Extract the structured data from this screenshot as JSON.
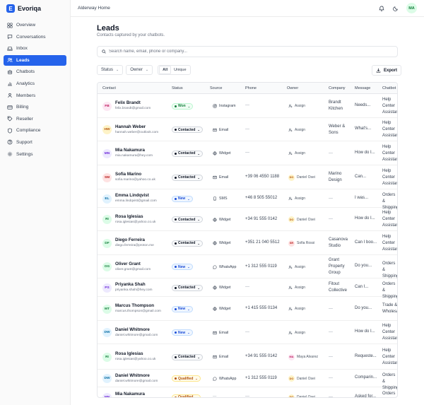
{
  "brand": {
    "name": "Evoriqa",
    "logo_letter": "E",
    "accent": "#2563eb"
  },
  "sidebar": {
    "items": [
      {
        "label": "Overview",
        "icon": "grid-icon"
      },
      {
        "label": "Conversations",
        "icon": "chat-icon"
      },
      {
        "label": "Inbox",
        "icon": "inbox-icon"
      },
      {
        "label": "Leads",
        "icon": "users-icon",
        "active": true
      },
      {
        "label": "Chatbots",
        "icon": "bot-icon"
      },
      {
        "label": "Analytics",
        "icon": "chart-icon"
      },
      {
        "label": "Members",
        "icon": "members-icon"
      },
      {
        "label": "Billing",
        "icon": "card-icon"
      },
      {
        "label": "Reseller",
        "icon": "tag-icon"
      },
      {
        "label": "Compliance",
        "icon": "shield-icon"
      },
      {
        "label": "Support",
        "icon": "help-icon"
      },
      {
        "label": "Settings",
        "icon": "gear-icon"
      }
    ]
  },
  "header": {
    "breadcrumb": "Alderway Home",
    "user_initials": "MA"
  },
  "page": {
    "title": "Leads",
    "subtitle": "Contacts captured by your chatbots.",
    "search_placeholder": "Search name, email, phone or company..."
  },
  "filters": {
    "status": "Status",
    "owner": "Owner",
    "seg_all": "All",
    "seg_unique": "Unique",
    "export": "Export"
  },
  "table": {
    "columns": [
      "Contact",
      "Status",
      "Source",
      "Phone",
      "Owner",
      "Company",
      "Message",
      "Chatbot"
    ],
    "rows": [
      {
        "initials": "FB",
        "name": "Felix Brandt",
        "email": "felix.brandt@gmail.com",
        "status": "Won",
        "source": "Instagram",
        "phone": "—",
        "owner": "Assign",
        "owner_initials": "",
        "company": "Brandt\nKitchen",
        "message": "Needs...",
        "chatbot": "Help\nCenter\nAssistant",
        "avatar_bg": "#fce7f3",
        "avatar_fg": "#be185d"
      },
      {
        "initials": "HW",
        "name": "Hannah Weber",
        "email": "hannah.weber@outlook.com",
        "status": "Contacted",
        "source": "Email",
        "phone": "—",
        "owner": "Assign",
        "owner_initials": "",
        "company": "Weber &\nSons",
        "message": "What's...",
        "chatbot": "Help\nCenter\nAssistant",
        "avatar_bg": "#fef3c7",
        "avatar_fg": "#b45309"
      },
      {
        "initials": "MN",
        "name": "Mia Nakamura",
        "email": "mia.nakamura@hey.com",
        "status": "Contacted",
        "source": "Widget",
        "phone": "—",
        "owner": "Assign",
        "owner_initials": "",
        "company": "—",
        "message": "How do I...",
        "chatbot": "Help\nCenter\nAssistant",
        "avatar_bg": "#ede9fe",
        "avatar_fg": "#6d28d9"
      },
      {
        "initials": "SM",
        "name": "Sofia Marino",
        "email": "sofia.marino@yahoo.co.uk",
        "status": "Contacted",
        "source": "Email",
        "phone": "+39 06 4550 1188",
        "owner": "Daniel Osei",
        "owner_initials": "DO",
        "company": "Marino\nDesign",
        "message": "Can...",
        "chatbot": "Help\nCenter\nAssistant",
        "avatar_bg": "#fee2e2",
        "avatar_fg": "#b91c1c"
      },
      {
        "initials": "EL",
        "name": "Emma Lindqvist",
        "email": "emma.lindqvist@gmail.com",
        "status": "New",
        "source": "SMS",
        "phone": "+46 8 505 55012",
        "owner": "Assign",
        "owner_initials": "",
        "company": "—",
        "message": "I was...",
        "chatbot": "Orders &\nShipping",
        "avatar_bg": "#e0f2fe",
        "avatar_fg": "#0369a1"
      },
      {
        "initials": "RI",
        "name": "Rosa Iglesias",
        "email": "rosa.iglesias@yahoo.co.uk",
        "status": "Contacted",
        "source": "Widget",
        "phone": "+34 91 555 0142",
        "owner": "Daniel Osei",
        "owner_initials": "DO",
        "company": "—",
        "message": "How do I...",
        "chatbot": "Help\nCenter\nAssistant",
        "avatar_bg": "#dcfce7",
        "avatar_fg": "#15803d"
      },
      {
        "initials": "DF",
        "name": "Diego Ferreira",
        "email": "diego.ferreira@proton.me",
        "status": "Contacted",
        "source": "Widget",
        "phone": "+351 21 040 5512",
        "owner": "Sofia Rossi",
        "owner_initials": "SR",
        "company": "Casanova\nStudio",
        "message": "Can I boo...",
        "chatbot": "Help\nCenter\nAssistant",
        "avatar_bg": "#dcfce7",
        "avatar_fg": "#15803d"
      },
      {
        "initials": "OG",
        "name": "Oliver Grant",
        "email": "oliver.grant@gmail.com",
        "status": "New",
        "source": "WhatsApp",
        "phone": "+1 312 555 0119",
        "owner": "Assign",
        "owner_initials": "",
        "company": "Grant\nProperty\nGroup",
        "message": "Do you...",
        "chatbot": "Orders &\nShipping",
        "avatar_bg": "#dcfce7",
        "avatar_fg": "#15803d"
      },
      {
        "initials": "PS",
        "name": "Priyanka Shah",
        "email": "priyanka.shah@hey.com",
        "status": "Contacted",
        "source": "Widget",
        "phone": "—",
        "owner": "Assign",
        "owner_initials": "",
        "company": "Fitout\nCollective",
        "message": "Can I...",
        "chatbot": "Orders &\nShipping",
        "avatar_bg": "#ede9fe",
        "avatar_fg": "#6d28d9"
      },
      {
        "initials": "MT",
        "name": "Marcus Thompson",
        "email": "marcus.thompson@gmail.com",
        "status": "New",
        "source": "Widget",
        "phone": "+1 415 555 0134",
        "owner": "Assign",
        "owner_initials": "",
        "company": "—",
        "message": "Do you...",
        "chatbot": "Trade &\nWholesale",
        "avatar_bg": "#dcfce7",
        "avatar_fg": "#15803d"
      },
      {
        "initials": "DW",
        "name": "Daniel Whitmore",
        "email": "daniel.whitmore@gmail.com",
        "status": "New",
        "source": "Email",
        "phone": "—",
        "owner": "Assign",
        "owner_initials": "",
        "company": "—",
        "message": "How do I...",
        "chatbot": "Help\nCenter\nAssistant",
        "avatar_bg": "#e0f2fe",
        "avatar_fg": "#0369a1"
      },
      {
        "initials": "RI",
        "name": "Rosa Iglesias",
        "email": "rosa.iglesias@yahoo.co.uk",
        "status": "Contacted",
        "source": "Email",
        "phone": "+34 91 555 0142",
        "owner": "Maya Alvarez",
        "owner_initials": "MA",
        "company": "—",
        "message": "Requeste...",
        "chatbot": "Help\nCenter\nAssistant",
        "avatar_bg": "#dcfce7",
        "avatar_fg": "#15803d"
      },
      {
        "initials": "DW",
        "name": "Daniel Whitmore",
        "email": "daniel.whitmore@gmail.com",
        "status": "Qualified",
        "source": "WhatsApp",
        "phone": "+1 312 555 0119",
        "owner": "Daniel Osei",
        "owner_initials": "DO",
        "company": "—",
        "message": "Comparin...",
        "chatbot": "Orders &\nShipping",
        "avatar_bg": "#e0f2fe",
        "avatar_fg": "#0369a1"
      },
      {
        "initials": "MN",
        "name": "Mia Nakamura",
        "email": "mia.nakamura@hey.com",
        "status": "Qualified",
        "source": "—",
        "phone": "—",
        "owner": "Daniel Osei",
        "owner_initials": "DO",
        "company": "—",
        "message": "Asked for...",
        "chatbot": "Orders &\nShipping",
        "avatar_bg": "#ede9fe",
        "avatar_fg": "#6d28d9"
      }
    ]
  },
  "status_colors": {
    "Won": {
      "bg": "#f0fdf4",
      "border": "#bbf7d0",
      "fg": "#15803d"
    },
    "Contacted": {
      "bg": "#f9fafb",
      "border": "#d1d5db",
      "fg": "#111827"
    },
    "New": {
      "bg": "#eff6ff",
      "border": "#bfdbfe",
      "fg": "#1d4ed8"
    },
    "Qualified": {
      "bg": "#fffbeb",
      "border": "#fde68a",
      "fg": "#b45309"
    }
  },
  "owner_colors": {
    "DO": {
      "bg": "#fef3c7",
      "fg": "#b45309"
    },
    "SR": {
      "bg": "#fee2e2",
      "fg": "#b91c1c"
    },
    "MA": {
      "bg": "#fce7f3",
      "fg": "#be185d"
    }
  }
}
